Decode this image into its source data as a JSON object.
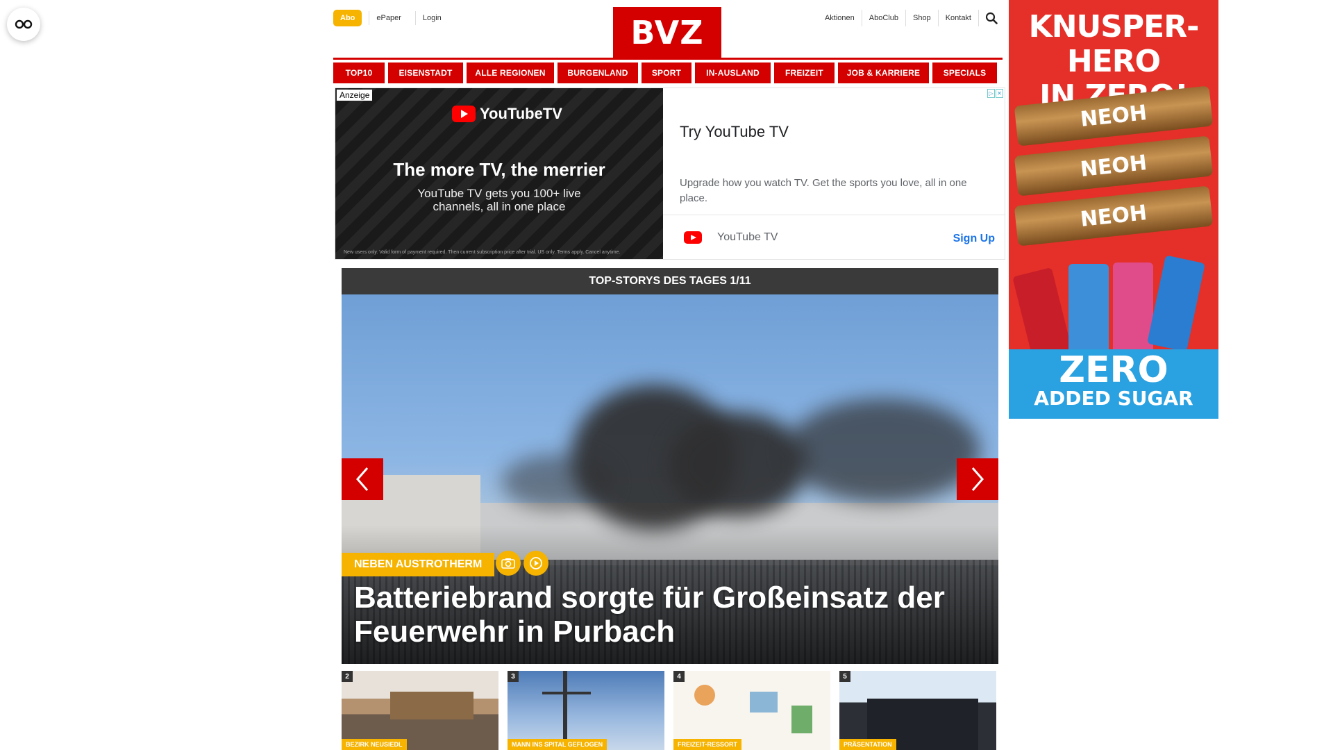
{
  "header": {
    "abo_label": "Abo",
    "left_links": [
      "ePaper",
      "Login"
    ],
    "logo_text": "BVZ",
    "right_links": [
      "Aktionen",
      "AboClub",
      "Shop",
      "Kontakt"
    ]
  },
  "nav": {
    "items": [
      "TOP10",
      "EISENSTADT",
      "ALLE REGIONEN",
      "BURGENLAND",
      "SPORT",
      "IN-AUSLAND",
      "FREIZEIT",
      "JOB & KARRIERE",
      "SPECIALS"
    ]
  },
  "ad_top": {
    "anzeige": "Anzeige",
    "brand": "YouTubeTV",
    "headline": "The more TV, the merrier",
    "subline": "YouTube TV gets you 100+ live channels, all in one place",
    "fineprint": "New users only. Valid form of payment required. Then current subscription price after trial. US only. Terms apply. Cancel anytime.",
    "title": "Try YouTube TV",
    "description": "Upgrade how you watch TV. Get the sports you love, all in one place.",
    "advertiser": "YouTube TV",
    "cta": "Sign Up"
  },
  "stories": {
    "header": "TOP-STORYS DES TAGES 1/11",
    "hero": {
      "kicker": "NEBEN AUSTROTHERM",
      "title": "Batteriebrand sorgte für Großeinsatz der Feuerwehr in Purbach"
    },
    "thumbs": [
      {
        "num": "2",
        "kicker": "BEZIRK NEUSIEDL"
      },
      {
        "num": "3",
        "kicker": "MANN INS SPITAL GEFLOGEN"
      },
      {
        "num": "4",
        "kicker": "FREIZEIT-RESSORT"
      },
      {
        "num": "5",
        "kicker": "PRÄSENTATION"
      }
    ]
  },
  "ad_side": {
    "title_line1": "KNUSPER-HERO",
    "title_line2": "IN ZERO!",
    "bar_label": "NEOH",
    "bottom_line1": "ZERO",
    "bottom_line2": "ADDED SUGAR"
  },
  "colors": {
    "brand_red": "#d40000",
    "accent_yellow": "#f6b300"
  }
}
